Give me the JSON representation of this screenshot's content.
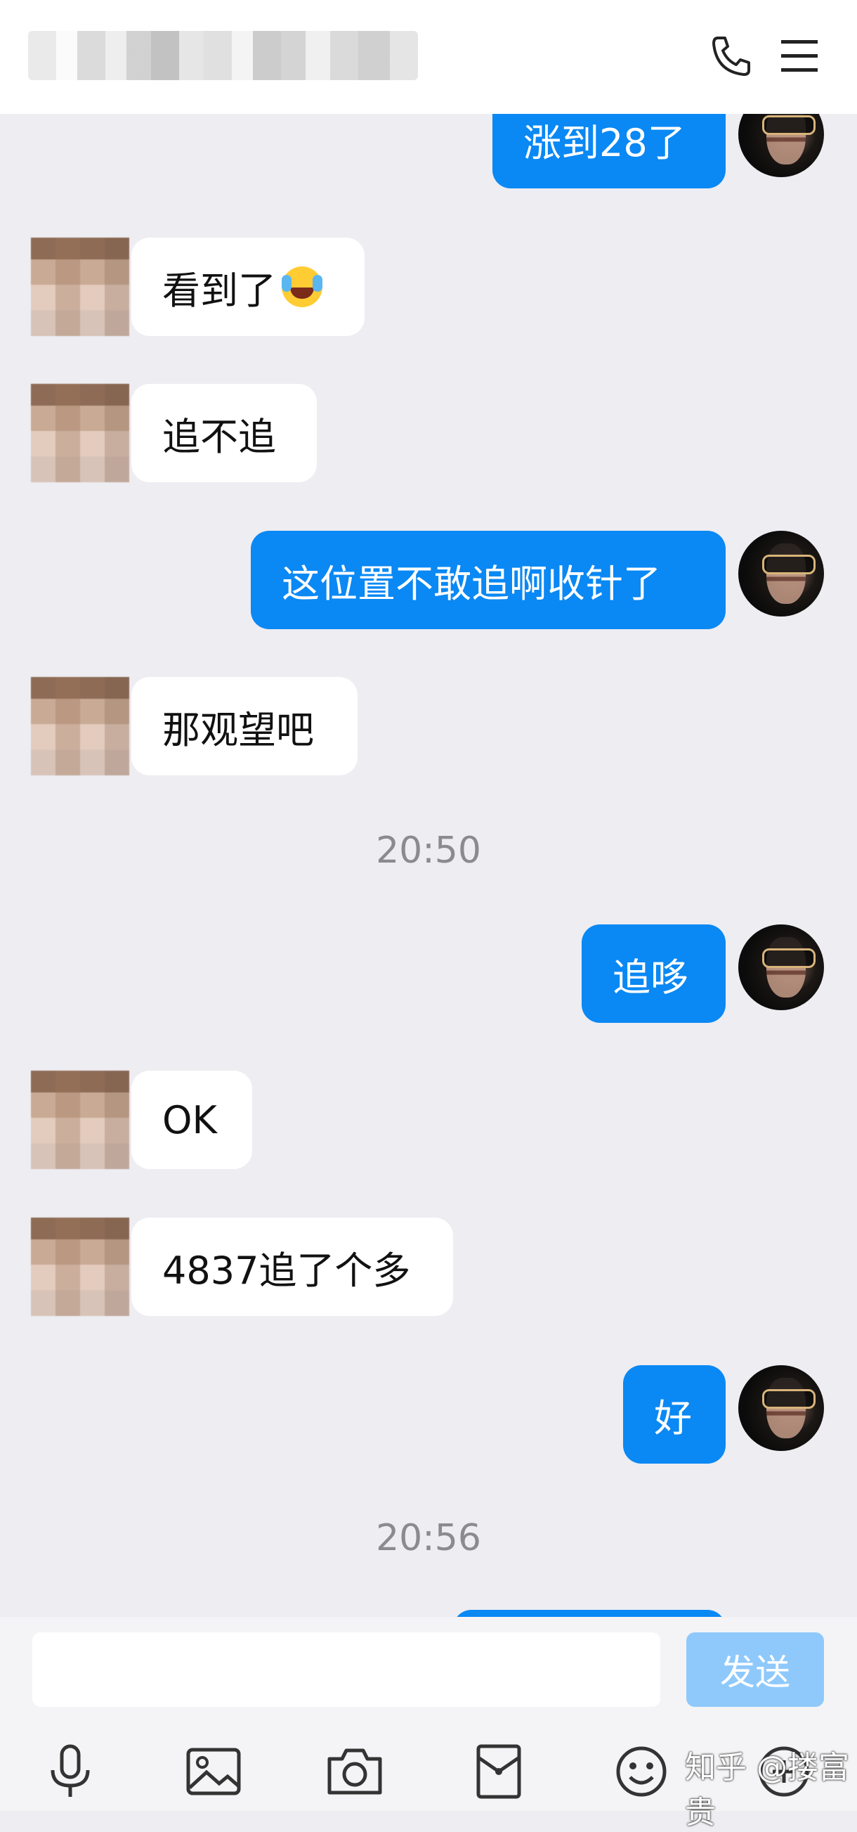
{
  "header": {
    "title_blurred": true,
    "icons": [
      "phone-icon",
      "menu-icon"
    ]
  },
  "messages": [
    {
      "side": "out",
      "text": "涨到28了"
    },
    {
      "side": "in",
      "text": "看到了",
      "emoji": "joy-emoji"
    },
    {
      "side": "in",
      "text": "追不追"
    },
    {
      "side": "out",
      "text": "这位置不敢追啊收针了"
    },
    {
      "side": "in",
      "text": "那观望吧"
    },
    {
      "type": "time",
      "text": "20:50"
    },
    {
      "side": "out",
      "text": "追哆"
    },
    {
      "side": "in",
      "text": "OK"
    },
    {
      "side": "in",
      "text": "4837追了个多"
    },
    {
      "side": "out",
      "text": "好"
    },
    {
      "type": "time",
      "text": "20:56"
    }
  ],
  "input": {
    "value": "",
    "send_label": "发送"
  },
  "toolbar": {
    "icons": [
      "microphone-icon",
      "image-icon",
      "camera-icon",
      "red-packet-icon",
      "smiley-icon",
      "plus-icon"
    ]
  },
  "watermark": "知乎 @搂富贵",
  "colors": {
    "outgoing_bubble": "#0a88f4",
    "send_disabled": "#8fc9fb",
    "background": "#ededf2"
  }
}
